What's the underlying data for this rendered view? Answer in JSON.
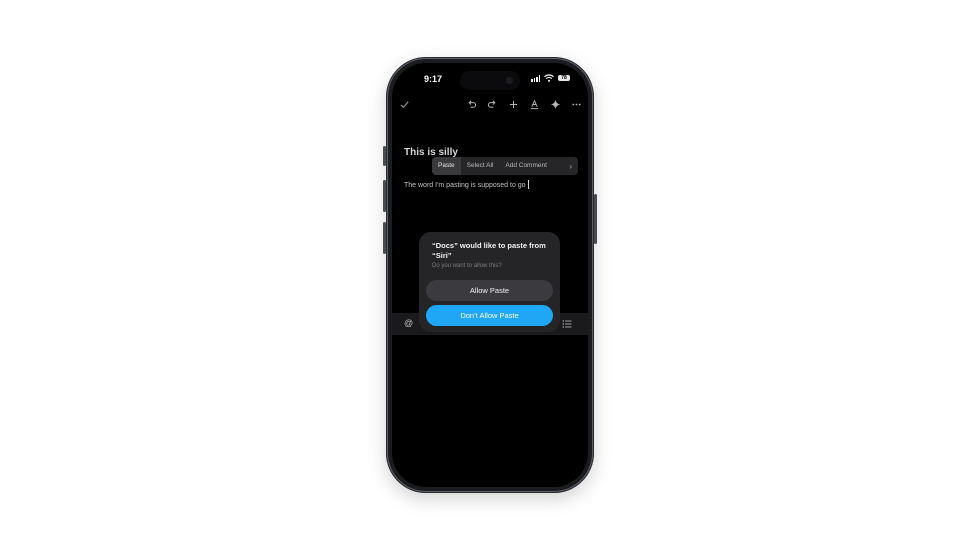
{
  "status_bar": {
    "time": "9:17",
    "battery": "78"
  },
  "toolbar": {
    "icons": [
      "check-icon",
      "undo-icon",
      "redo-icon",
      "plus-icon",
      "text-format-icon",
      "sparkle-icon",
      "more-icon"
    ]
  },
  "document": {
    "title": "This is silly",
    "body": "The word I'm pasting is supposed to go"
  },
  "context_menu": {
    "items": [
      "Paste",
      "Select All",
      "Add Comment"
    ],
    "more": "›"
  },
  "format_bar": {
    "left_icon": "@"
  },
  "dialog": {
    "title": "“Docs” would like to paste from “Siri”",
    "subtitle": "Do you want to allow this?",
    "allow_label": "Allow Paste",
    "deny_label": "Don’t Allow Paste"
  },
  "colors": {
    "accent": "#1fa6f5",
    "dialog_bg": "#252528",
    "screen_bg": "#000000"
  }
}
